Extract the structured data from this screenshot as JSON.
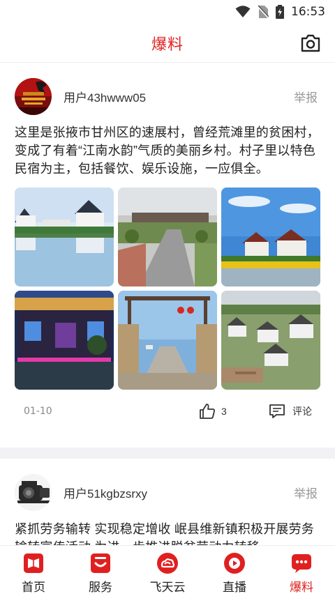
{
  "status_bar": {
    "time": "16:53"
  },
  "header": {
    "title": "爆料"
  },
  "colors": {
    "accent": "#e02020",
    "muted": "#999999"
  },
  "posts": [
    {
      "username": "用户43hwww05",
      "report_label": "举报",
      "text": "这里是张掖市甘州区的速展村，曾经荒滩里的贫困村，变成了有着“江南水韵”气质的美丽乡村。村子里以特色民宿为主，包括餐饮、娱乐设施，一应俱全。",
      "image_count": 6,
      "date": "01-10",
      "like_count": "3",
      "comment_label": "评论"
    },
    {
      "username": "用户51kgbzsrxy",
      "report_label": "举报",
      "text": "紧抓劳务输转 实现稳定增收 岷县维新镇积极开展劳务输转宣传活动 为进一步推进脱贫劳动力转移"
    }
  ],
  "tabs": [
    {
      "label": "首页",
      "icon": "home-book-icon"
    },
    {
      "label": "服务",
      "icon": "service-smile-icon"
    },
    {
      "label": "飞天云",
      "icon": "cloud-icon"
    },
    {
      "label": "直播",
      "icon": "live-play-icon"
    },
    {
      "label": "爆料",
      "icon": "chat-dots-icon",
      "active": true
    }
  ]
}
